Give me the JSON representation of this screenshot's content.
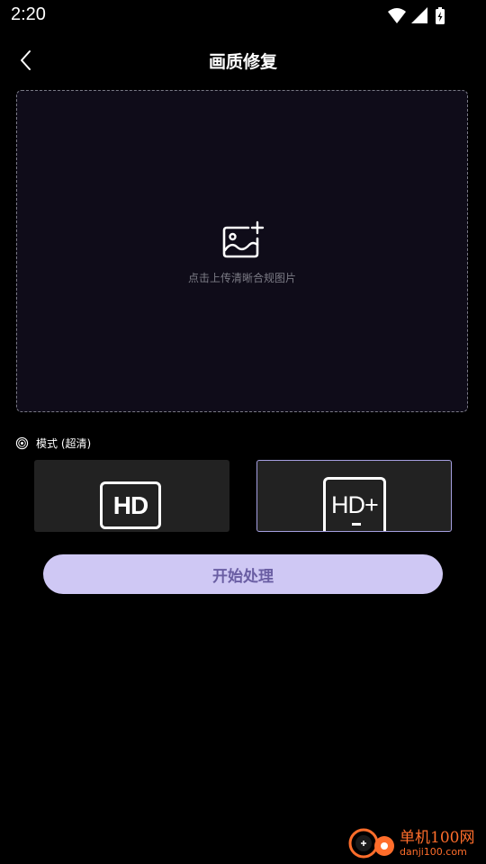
{
  "status_bar": {
    "time": "2:20",
    "icons": [
      "wifi-icon",
      "cellular-signal-icon",
      "battery-charging-icon"
    ]
  },
  "app_bar": {
    "back_icon": "chevron-left-icon",
    "title": "画质修复"
  },
  "upload": {
    "icon": "add-image-icon",
    "hint": "点击上传清晰合规图片"
  },
  "mode": {
    "icon": "mode-dial-icon",
    "label": "模式 (超清)",
    "options": [
      {
        "label": "HD",
        "selected": false
      },
      {
        "label": "HD+",
        "selected": true
      }
    ]
  },
  "actions": {
    "start_label": "开始处理"
  },
  "watermark": {
    "name": "单机100网",
    "url": "danji100.com"
  },
  "colors": {
    "background": "#000000",
    "upload_bg": "#0f0c19",
    "card_bg": "#222222",
    "selected_border": "#a59fe0",
    "button_bg": "#cfc8f4",
    "button_text": "#6a5ea3",
    "hint_text": "#7b7b85",
    "watermark": "#ff6d2b"
  }
}
